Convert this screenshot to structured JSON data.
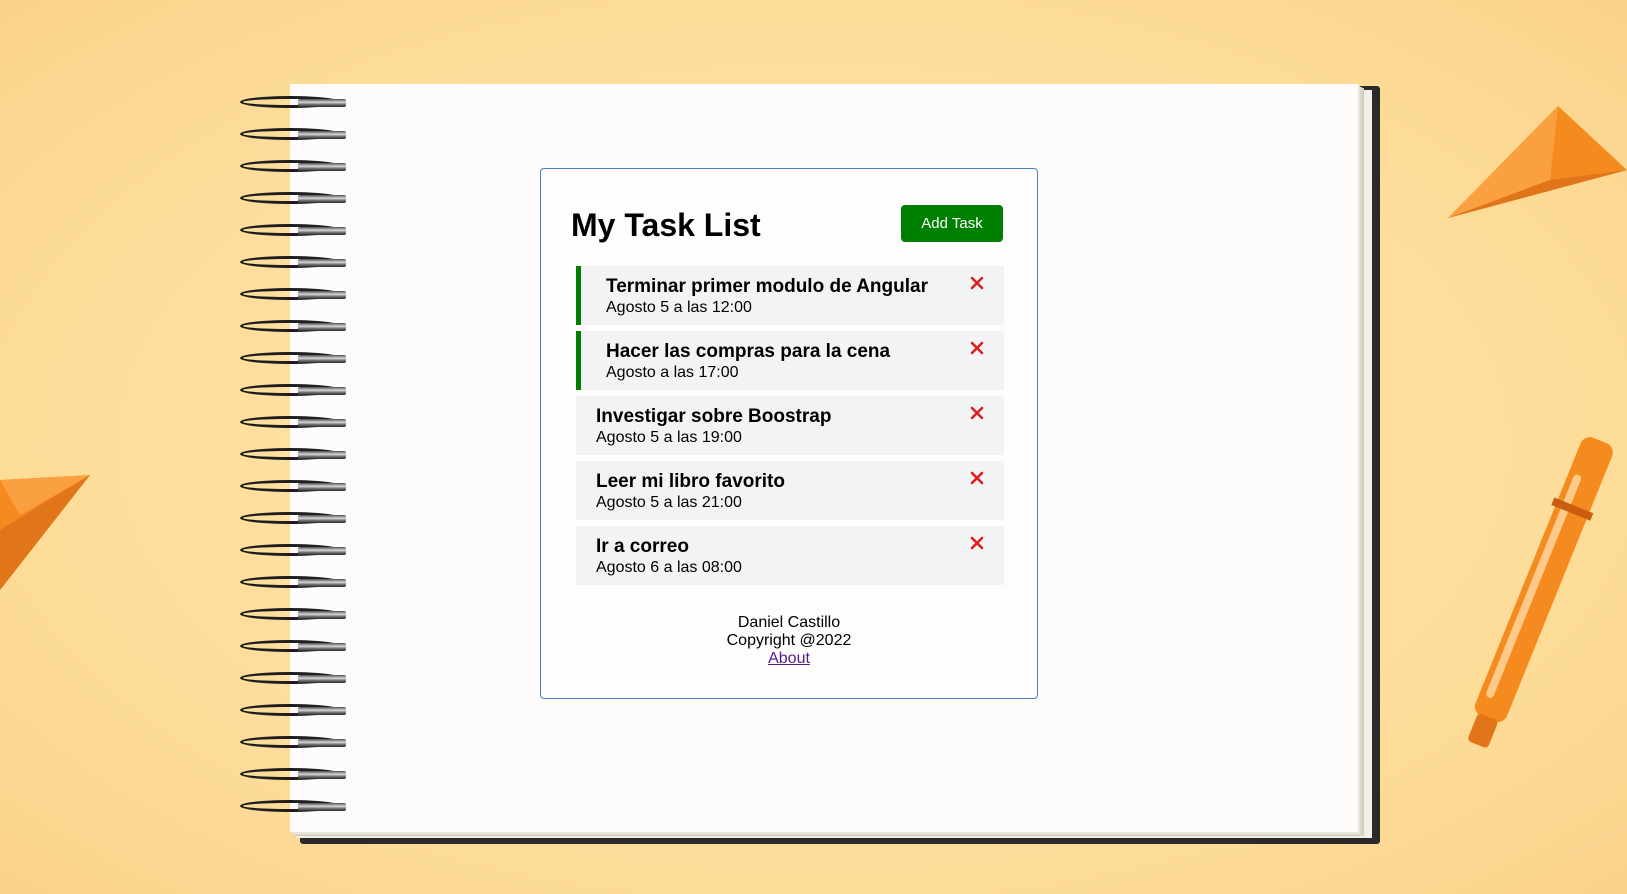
{
  "app": {
    "title": "My Task List",
    "add_button_label": "Add Task"
  },
  "tasks": [
    {
      "text": "Terminar primer modulo de Angular",
      "day": "Agosto 5 a las 12:00",
      "reminder": true
    },
    {
      "text": "Hacer las compras para la cena",
      "day": "Agosto a las 17:00",
      "reminder": true
    },
    {
      "text": "Investigar sobre Boostrap",
      "day": "Agosto 5 a las 19:00",
      "reminder": false
    },
    {
      "text": "Leer mi libro favorito",
      "day": "Agosto 5 a las 21:00",
      "reminder": false
    },
    {
      "text": "Ir a correo",
      "day": "Agosto 6 a las 08:00",
      "reminder": false
    }
  ],
  "footer": {
    "author": "Daniel Castillo",
    "copyright": "Copyright @2022",
    "about_link": "About"
  },
  "colors": {
    "accent": "#008000",
    "delete": "#e11d1d",
    "card_border": "#4a7fc1",
    "task_bg": "#f2f3f5",
    "link": "#551a8b"
  },
  "icons": {
    "delete": "close-icon"
  }
}
